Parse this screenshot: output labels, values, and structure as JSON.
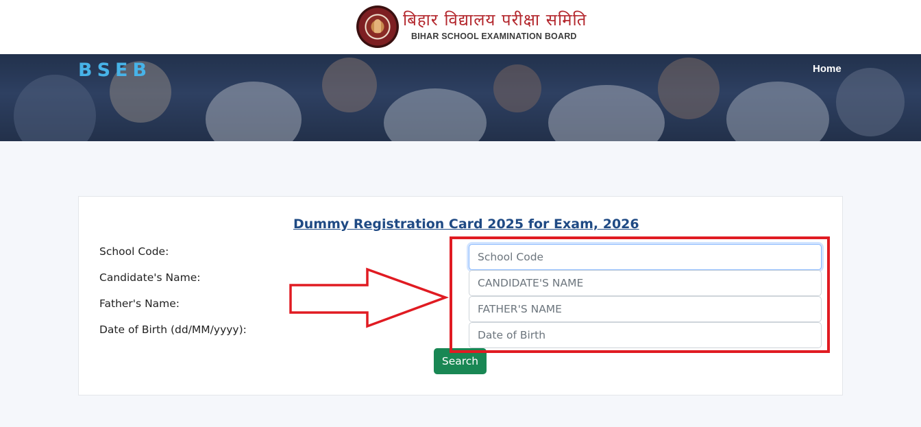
{
  "header": {
    "brand_hindi": "बिहार विद्यालय परीक्षा समिति",
    "brand_english": "BIHAR SCHOOL EXAMINATION BOARD"
  },
  "nav": {
    "logo": "BSEB",
    "home": "Home"
  },
  "form": {
    "title": "Dummy Registration Card 2025 for Exam, 2026",
    "labels": {
      "school_code": "School Code:",
      "candidate_name": "Candidate's Name:",
      "father_name": "Father's Name:",
      "dob": "Date of Birth (dd/MM/yyyy):"
    },
    "placeholders": {
      "school_code": "School Code",
      "candidate_name": "CANDIDATE'S NAME",
      "father_name": "FATHER'S NAME",
      "dob": "Date of Birth"
    },
    "values": {
      "school_code": "",
      "candidate_name": "",
      "father_name": "",
      "dob": ""
    },
    "search_label": "Search"
  },
  "colors": {
    "accent_link": "#1f4a84",
    "logo_text": "#47b3e8",
    "button": "#198754",
    "annotation": "#e01b22"
  }
}
